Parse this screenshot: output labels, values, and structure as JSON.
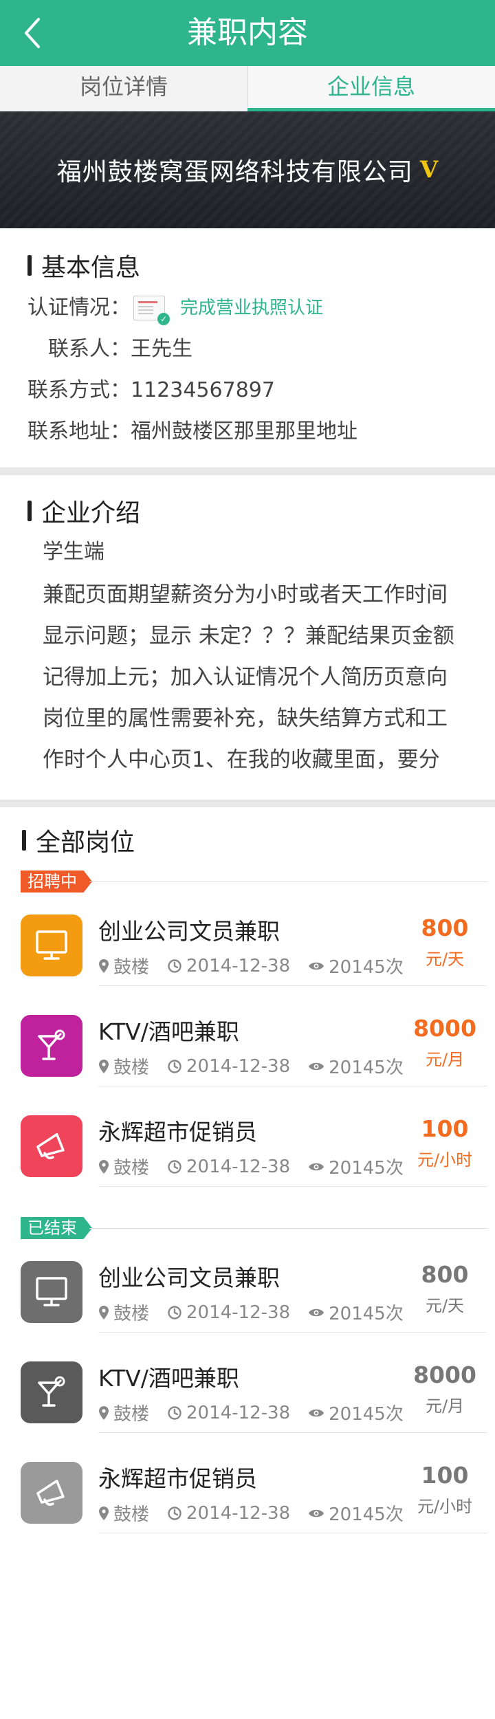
{
  "header": {
    "title": "兼职内容"
  },
  "tabs": [
    {
      "label": "岗位详情",
      "active": false
    },
    {
      "label": "企业信息",
      "active": true
    }
  ],
  "company": {
    "name": "福州鼓楼窝蛋网络科技有限公司",
    "verified_badge": "V"
  },
  "basic_info": {
    "title": "基本信息",
    "cert_label": "认证情况：",
    "cert_status": "完成营业执照认证",
    "contact_label": "联系人：",
    "contact_value": "王先生",
    "phone_label": "联系方式：",
    "phone_value": "11234567897",
    "address_label": "联系地址：",
    "address_value": "福州鼓楼区那里那里地址"
  },
  "intro": {
    "title": "企业介绍",
    "subtitle": "学生端",
    "body": "兼配页面期望薪资分为小时或者天工作时间显示问题；显示 未定？？？兼配结果页金额记得加上元；加入认证情况个人简历页意向岗位里的属性需要补充，缺失结算方式和工作时个人中心页1、在我的收藏里面，要分岗位收藏和企业收藏；去除昵称这个属性；个人简介归到基本信息；联系方式去除电子邮箱；认证分"
  },
  "jobs": {
    "title": "全部岗位",
    "groups": [
      {
        "status": "招聘中",
        "status_color": "#f05a28",
        "items": [
          {
            "name": "创业公司文员兼职",
            "location": "鼓楼",
            "date": "2014-12-38",
            "views": "20145次",
            "price": "800",
            "unit": "元/天",
            "icon": "monitor-icon",
            "color": "#f39c12"
          },
          {
            "name": "KTV/酒吧兼职",
            "location": "鼓楼",
            "date": "2014-12-38",
            "views": "20145次",
            "price": "8000",
            "unit": "元/月",
            "icon": "cocktail-icon",
            "color": "#c0229e"
          },
          {
            "name": "永辉超市促销员",
            "location": "鼓楼",
            "date": "2014-12-38",
            "views": "20145次",
            "price": "100",
            "unit": "元/小时",
            "icon": "megaphone-icon",
            "color": "#f0445a"
          }
        ]
      },
      {
        "status": "已结束",
        "status_color": "#2fb58c",
        "items": [
          {
            "name": "创业公司文员兼职",
            "location": "鼓楼",
            "date": "2014-12-38",
            "views": "20145次",
            "price": "800",
            "unit": "元/天",
            "icon": "monitor-icon",
            "color": "#6e6e6e"
          },
          {
            "name": "KTV/酒吧兼职",
            "location": "鼓楼",
            "date": "2014-12-38",
            "views": "20145次",
            "price": "8000",
            "unit": "元/月",
            "icon": "cocktail-icon",
            "color": "#5a5a5a"
          },
          {
            "name": "永辉超市促销员",
            "location": "鼓楼",
            "date": "2014-12-38",
            "views": "20145次",
            "price": "100",
            "unit": "元/小时",
            "icon": "megaphone-icon",
            "color": "#9a9a9a"
          }
        ]
      }
    ]
  }
}
